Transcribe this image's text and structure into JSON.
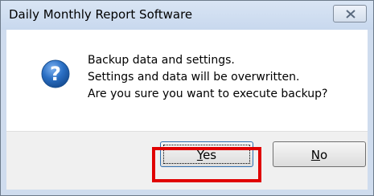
{
  "window": {
    "title": "Daily Monthly Report Software"
  },
  "icon": {
    "type": "question-icon",
    "glyph": "?",
    "color": "#1f63b8"
  },
  "message": {
    "lines": [
      "Backup data and settings.",
      "Settings and data will be overwritten.",
      "Are you sure you want to execute backup?"
    ]
  },
  "buttons": {
    "yes": {
      "label_mnemonic": "Y",
      "label_rest": "es"
    },
    "no": {
      "label_mnemonic": "N",
      "label_rest": "o"
    }
  },
  "highlight": {
    "color": "#e00000",
    "target": "yes-button"
  }
}
